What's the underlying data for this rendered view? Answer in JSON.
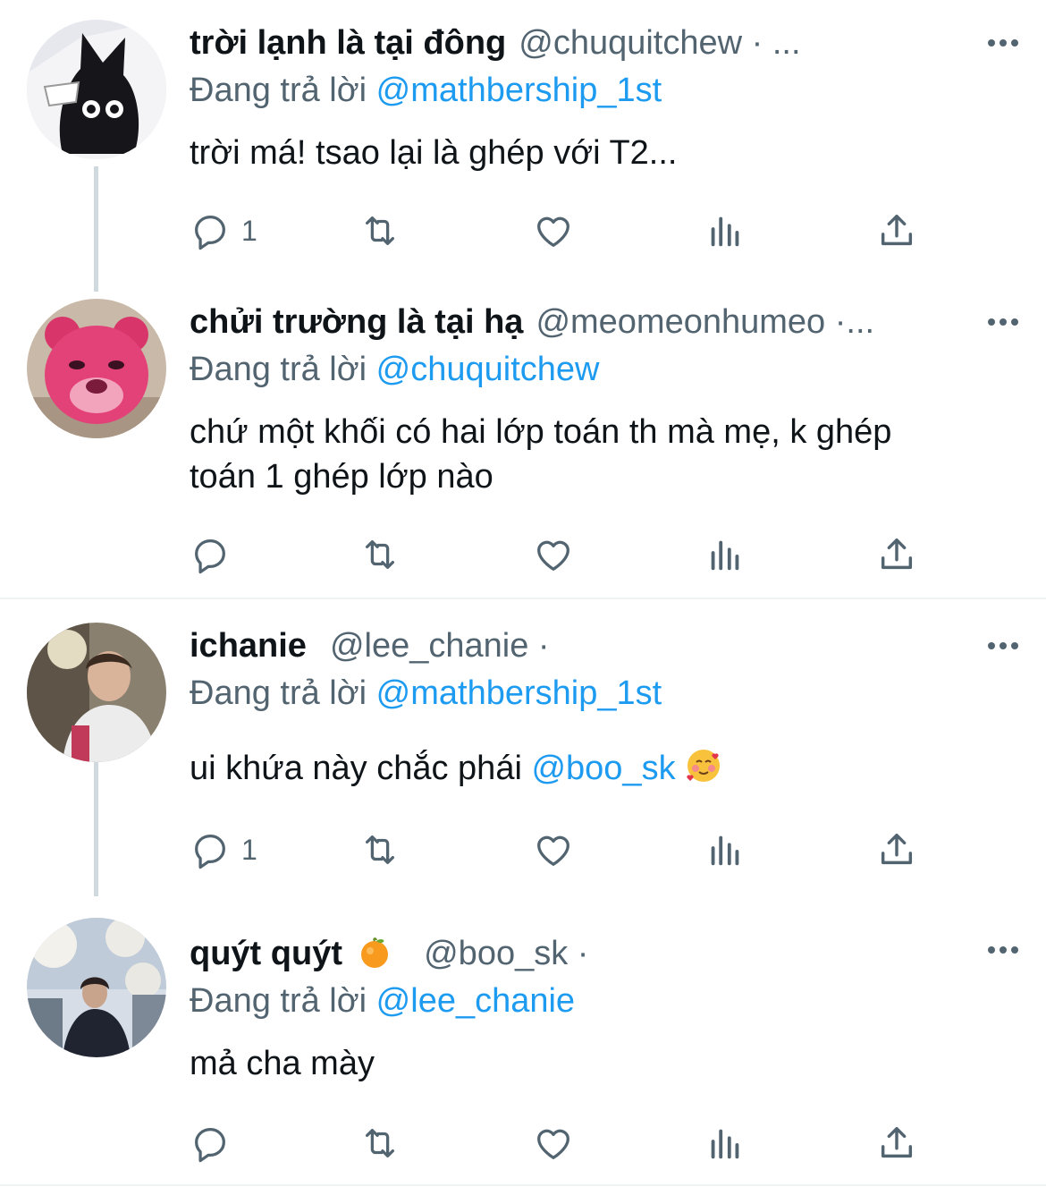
{
  "reply_prefix": "Đang trả lời",
  "tweets": [
    {
      "name": "trời lạnh là tại đông",
      "handle": "@chuquitchew · ...",
      "reply_to": "@mathbership_1st",
      "text": "trời má! tsao lại là ghép với T2...",
      "reply_count": "1"
    },
    {
      "name": "chửi trường là tại hạ",
      "handle": "@meomeonhumeo ·...",
      "reply_to": "@chuquitchew",
      "text_line1": "chứ một khối có hai lớp toán th mà mẹ, k ghép",
      "text_line2": "toán 1 ghép lớp nào",
      "reply_count": ""
    },
    {
      "name": "ichanie",
      "handle": "@lee_chanie ·",
      "reply_to": "@mathbership_1st",
      "text": "ui khứa này chắc phái ",
      "text_mention": "@boo_sk",
      "reply_count": "1"
    },
    {
      "name": "quýt quýt",
      "handle": "@boo_sk ·",
      "reply_to": "@lee_chanie",
      "text": "mả cha mày",
      "reply_count": ""
    }
  ],
  "icons": [
    "reply-icon",
    "retweet-icon",
    "like-icon",
    "analytics-icon",
    "share-icon",
    "more-icon"
  ],
  "colors": {
    "link": "#1d9bf0",
    "secondary": "#536471",
    "text": "#0f1419",
    "thread_line": "#cfd9de"
  }
}
